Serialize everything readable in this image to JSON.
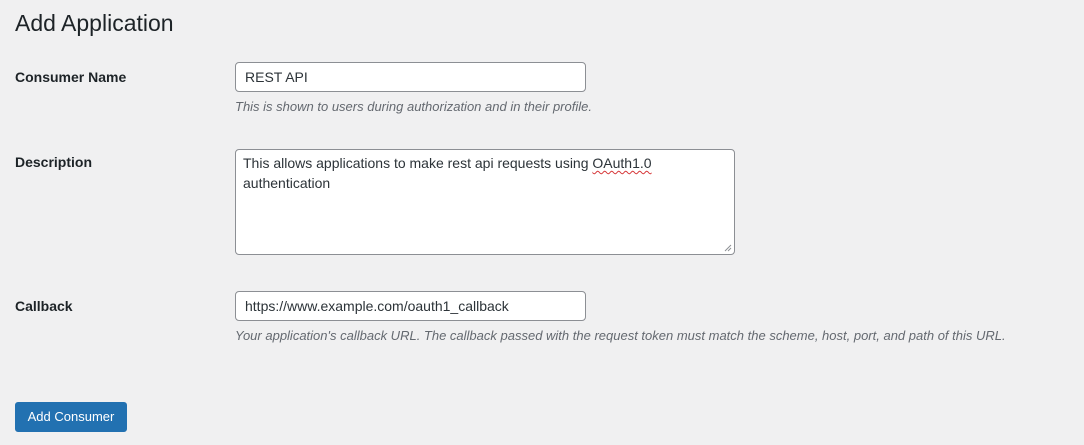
{
  "page": {
    "title": "Add Application"
  },
  "form": {
    "consumer_name": {
      "label": "Consumer Name",
      "value": "REST API",
      "hint": "This is shown to users during authorization and in their profile."
    },
    "description": {
      "label": "Description",
      "value_before": "This allows applications to make rest api requests using ",
      "value_misspelled": "OAuth1.0",
      "value_after": " authentication"
    },
    "callback": {
      "label": "Callback",
      "value": "https://www.example.com/oauth1_callback",
      "hint": "Your application's callback URL. The callback passed with the request token must match the scheme, host, port, and path of this URL."
    },
    "submit_label": "Add Consumer"
  },
  "colors": {
    "background": "#f0f0f1",
    "primary_button": "#2271b1",
    "input_border": "#8c8f94",
    "hint_text": "#646970",
    "spellcheck_underline": "#d63638"
  }
}
